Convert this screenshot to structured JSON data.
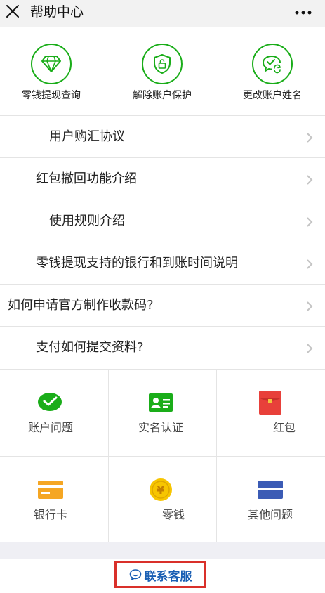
{
  "header": {
    "title": "帮助中心",
    "close_icon": "close-icon",
    "more_icon": "more-dots-icon"
  },
  "quick_actions": [
    {
      "label": "零钱提现查询",
      "icon": "diamond-icon"
    },
    {
      "label": "解除账户保护",
      "icon": "shield-lock-icon"
    },
    {
      "label": "更改账户姓名",
      "icon": "chat-refresh-icon"
    }
  ],
  "faq": [
    {
      "label": "用户购汇协议"
    },
    {
      "label": "红包撤回功能介绍"
    },
    {
      "label": "使用规则介绍"
    },
    {
      "label": "零钱提现支持的银行和到账时间说明"
    },
    {
      "label": "如何申请官方制作收款码?"
    },
    {
      "label": "支付如何提交资料?"
    }
  ],
  "categories": [
    {
      "label": "账户问题",
      "icon": "wechat-pay-icon"
    },
    {
      "label": "实名认证",
      "icon": "id-card-icon"
    },
    {
      "label": "红包",
      "icon": "red-packet-icon"
    },
    {
      "label": "银行卡",
      "icon": "bank-card-icon"
    },
    {
      "label": "零钱",
      "icon": "yuan-coin-icon"
    },
    {
      "label": "其他问题",
      "icon": "other-card-icon"
    }
  ],
  "footer": {
    "contact_label": "联系客服",
    "contact_icon": "chat-bubble-icon"
  },
  "colors": {
    "green": "#1aad19",
    "red": "#d9302a",
    "link_blue": "#1a5fb4",
    "orange": "#f5a623",
    "blue": "#3b5bb5",
    "gold": "#f7c500"
  }
}
